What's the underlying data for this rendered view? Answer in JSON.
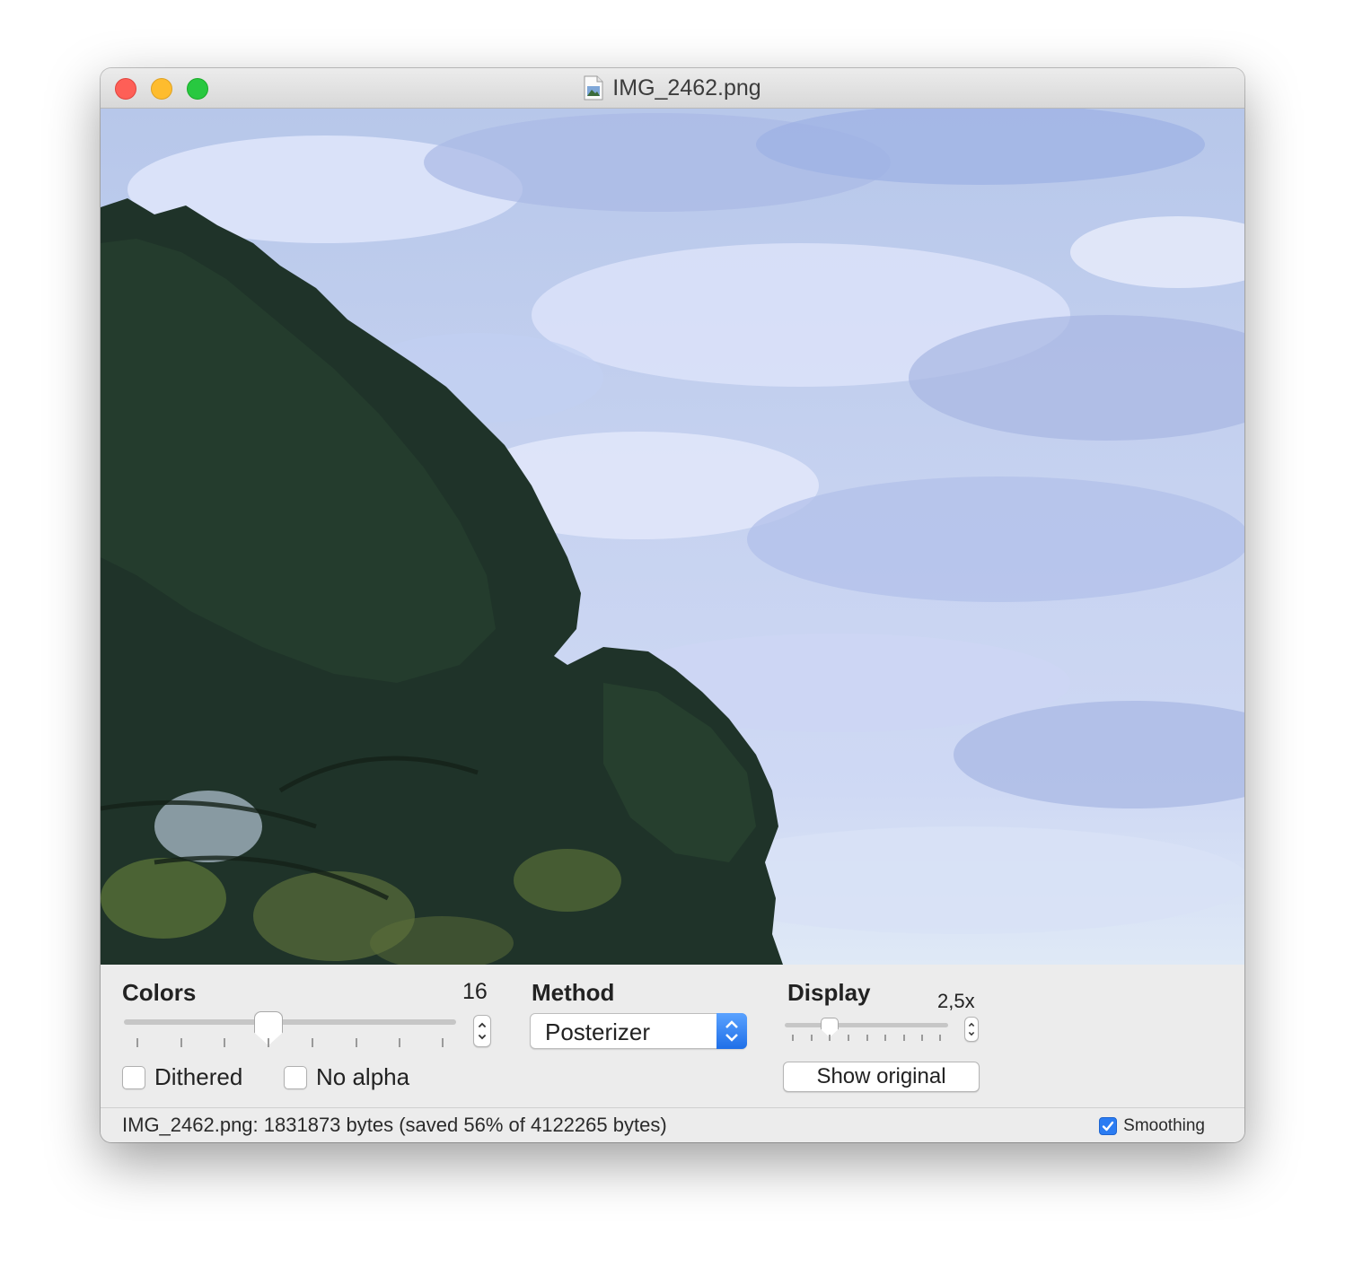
{
  "window": {
    "title": "IMG_2462.png",
    "file_icon": "png-document-icon"
  },
  "controls": {
    "colors": {
      "label": "Colors",
      "value": "16"
    },
    "method": {
      "label": "Method",
      "selected": "Posterizer"
    },
    "display": {
      "label": "Display",
      "value": "2,5x"
    },
    "dithered": {
      "label": "Dithered",
      "checked": false
    },
    "no_alpha": {
      "label": "No alpha",
      "checked": false
    },
    "show_original": {
      "label": "Show original"
    }
  },
  "status": {
    "text": "IMG_2462.png: 1831873 bytes (saved 56% of 4122265 bytes)",
    "smoothing": {
      "label": "Smoothing",
      "checked": true
    }
  },
  "colors": {
    "accent": "#2b7cf2",
    "close": "#fe5f57",
    "minimize": "#febc2e",
    "zoom": "#28c840"
  }
}
